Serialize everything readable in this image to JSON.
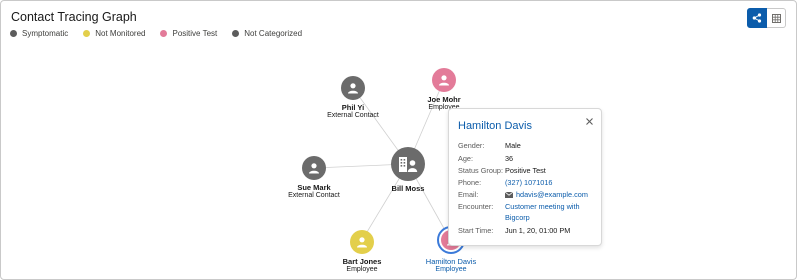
{
  "title": "Contact Tracing Graph",
  "toolbar": {
    "graph_view_icon": "share-graph-icon",
    "table_view_icon": "table-icon"
  },
  "legend": [
    {
      "label": "Symptomatic",
      "color": "#5c5c5c"
    },
    {
      "label": "Not Monitored",
      "color": "#e3cf4b"
    },
    {
      "label": "Positive Test",
      "color": "#e37b99"
    },
    {
      "label": "Not Categorized",
      "color": "#5c5c5c"
    }
  ],
  "nodes": {
    "phil": {
      "name": "Phil Yi",
      "role": "External Contact",
      "color": "#6b6b6b"
    },
    "joe": {
      "name": "Joe Mohr",
      "role": "Employee",
      "color": "#e37b99"
    },
    "bill": {
      "name": "Bill Moss",
      "role": "",
      "color": "#6b6b6b"
    },
    "sue": {
      "name": "Sue Mark",
      "role": "External Contact",
      "color": "#6b6b6b"
    },
    "bart": {
      "name": "Bart Jones",
      "role": "Employee",
      "color": "#e3cf4b"
    },
    "hamilton": {
      "name": "Hamilton Davis",
      "role": "Employee",
      "color": "#e37b99"
    }
  },
  "popover": {
    "name": "Hamilton Davis",
    "gender_label": "Gender:",
    "gender": "Male",
    "age_label": "Age:",
    "age": "36",
    "status_label": "Status Group:",
    "status": "Positive Test",
    "phone_label": "Phone:",
    "phone": "(327) 1071016",
    "email_label": "Email:",
    "email": "hdavis@example.com",
    "encounter_label": "Encounter:",
    "encounter_line1": "Customer meeting with",
    "encounter_line2": "Bigcorp",
    "start_label": "Start Time:",
    "start": "Jun 1, 20, 01:00 PM"
  }
}
